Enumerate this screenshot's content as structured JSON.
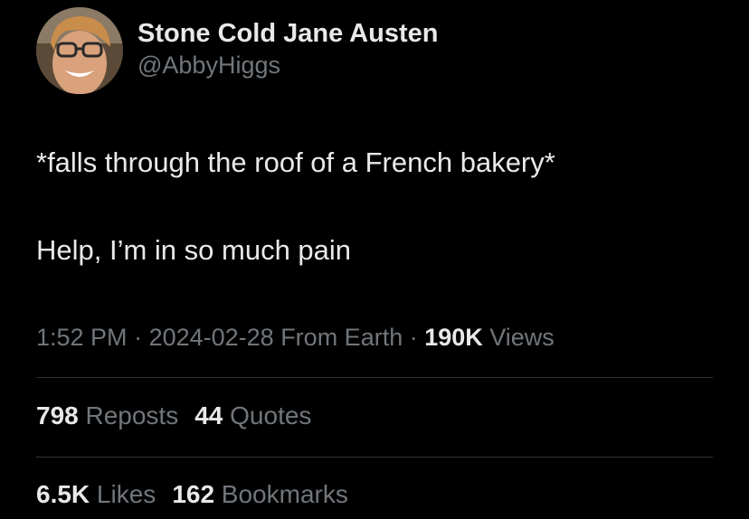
{
  "author": {
    "display_name": "Stone Cold Jane Austen",
    "handle": "@AbbyHiggs",
    "avatar_icon": "user-avatar-photo"
  },
  "tweet": {
    "line1": "*falls through the roof of a French bakery*",
    "line2": "Help, I’m in so much pain"
  },
  "meta": {
    "time": "1:52 PM",
    "sep1": " · ",
    "date": "2024-02-28",
    "source": " From Earth",
    "sep2": " · ",
    "views_count": "190K",
    "views_label": " Views"
  },
  "stats": {
    "reposts_count": "798",
    "reposts_label": " Reposts",
    "quotes_count": "44",
    "quotes_label": " Quotes",
    "likes_count": "6.5K",
    "likes_label": " Likes",
    "bookmarks_count": "162",
    "bookmarks_label": " Bookmarks"
  },
  "colors": {
    "background": "#000000",
    "primary_text": "#e7e9ea",
    "secondary_text": "#71767b",
    "divider": "#2f3336"
  }
}
